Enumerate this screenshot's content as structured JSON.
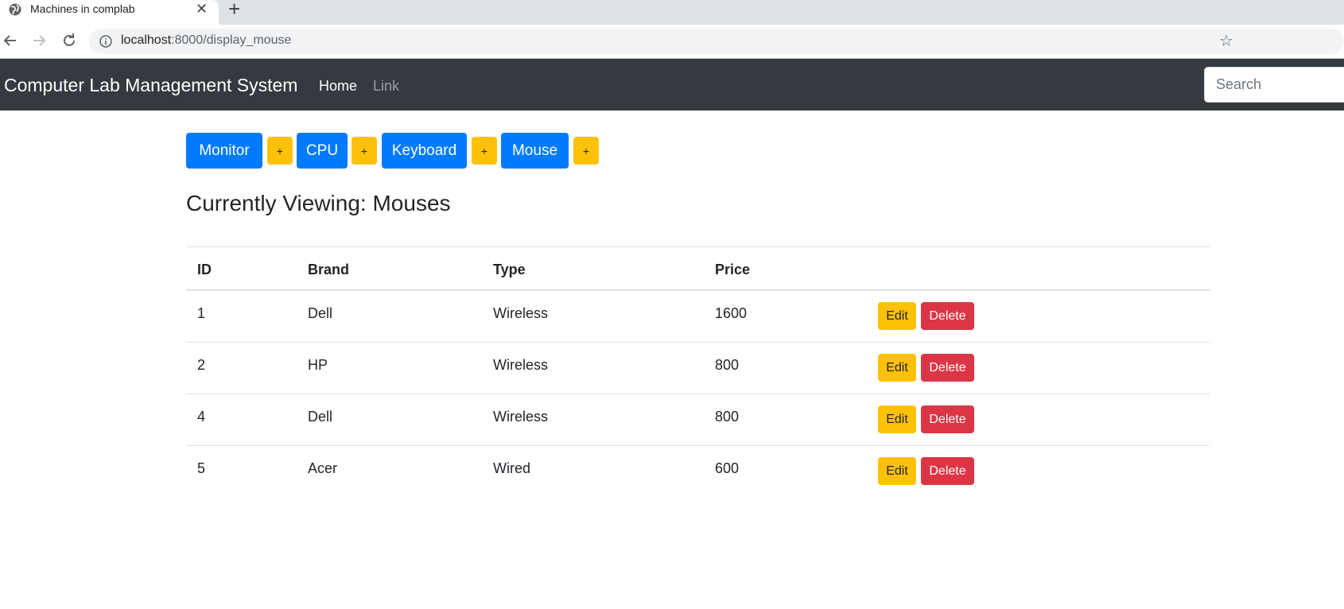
{
  "browser": {
    "tab_title": "Machines in complab",
    "close_glyph": "✕",
    "new_tab_glyph": "+",
    "url_host": "localhost",
    "url_path": ":8000/display_mouse",
    "star_glyph": "☆"
  },
  "navbar": {
    "brand": "Computer Lab Management System",
    "links": [
      "Home",
      "Link"
    ],
    "search_placeholder": "Search"
  },
  "categories": [
    {
      "label": "Monitor",
      "add_label": "+"
    },
    {
      "label": "CPU",
      "add_label": "+"
    },
    {
      "label": "Keyboard",
      "add_label": "+"
    },
    {
      "label": "Mouse",
      "add_label": "+"
    }
  ],
  "heading": "Currently Viewing: Mouses",
  "table": {
    "headers": [
      "ID",
      "Brand",
      "Type",
      "Price"
    ],
    "rows": [
      {
        "id": "1",
        "brand": "Dell",
        "type": "Wireless",
        "price": "1600"
      },
      {
        "id": "2",
        "brand": "HP",
        "type": "Wireless",
        "price": "800"
      },
      {
        "id": "4",
        "brand": "Dell",
        "type": "Wireless",
        "price": "800"
      },
      {
        "id": "5",
        "brand": "Acer",
        "type": "Wired",
        "price": "600"
      }
    ],
    "edit_label": "Edit",
    "delete_label": "Delete"
  },
  "colors": {
    "primary": "#007bff",
    "warning": "#ffc107",
    "danger": "#dc3545",
    "navbar": "#343a40"
  }
}
